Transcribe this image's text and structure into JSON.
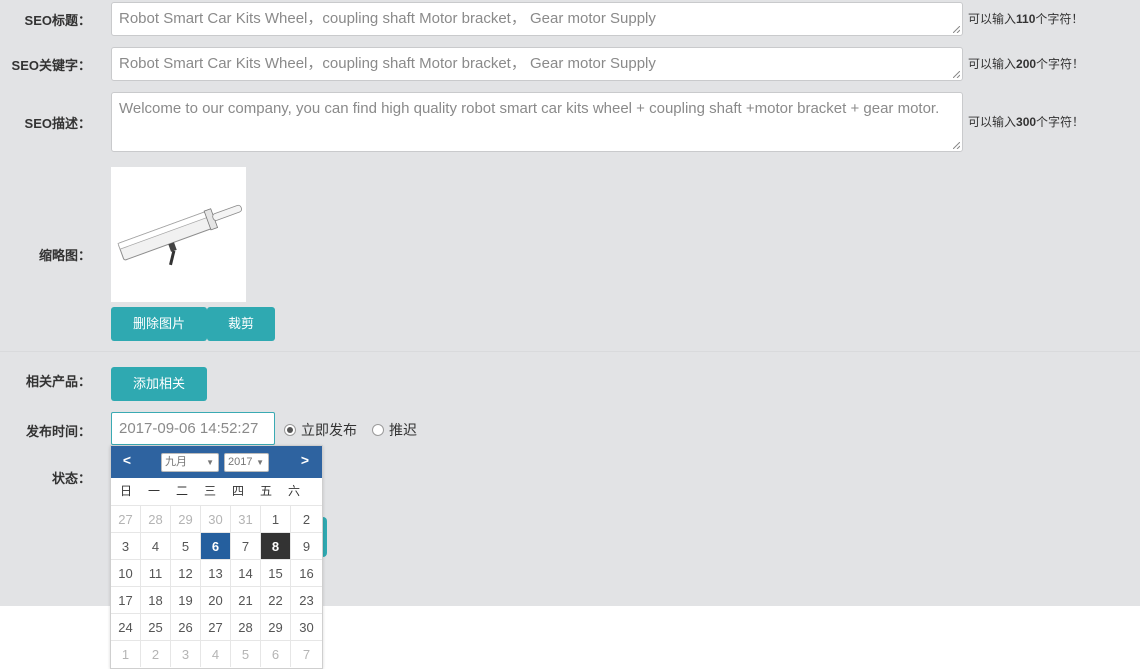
{
  "seo": {
    "title_label": "SEO标题：",
    "title_value": "Robot Smart Car Kits Wheel，coupling shaft  Motor bracket， Gear motor Supply",
    "title_hint_pre": "可以输入",
    "title_hint_num": "110",
    "title_hint_post": "个字符！",
    "keywords_label": "SEO关键字：",
    "keywords_value": "Robot Smart Car Kits Wheel，coupling shaft  Motor bracket， Gear motor Supply",
    "keywords_hint_pre": "可以输入",
    "keywords_hint_num": "200",
    "keywords_hint_post": "个字符！",
    "desc_label": "SEO描述：",
    "desc_value": "Welcome to our company, you can find high quality robot smart car kits wheel + coupling shaft +motor bracket + gear motor.",
    "desc_hint_pre": "可以输入",
    "desc_hint_num": "300",
    "desc_hint_post": "个字符！"
  },
  "thumbnail": {
    "label": "缩略图：",
    "delete_button": "删除图片",
    "crop_button": "裁剪"
  },
  "related": {
    "label": "相关产品：",
    "add_button": "添加相关"
  },
  "publish": {
    "label": "发布时间：",
    "datetime_value": "2017-09-06 14:52:27",
    "option_now": "立即发布",
    "option_delay": "推迟"
  },
  "status": {
    "label": "状态："
  },
  "calendar": {
    "month": "九月",
    "year": "2017",
    "prev": "<",
    "next": ">",
    "weekdays": [
      "日",
      "一",
      "二",
      "三",
      "四",
      "五",
      "六"
    ],
    "weeks": [
      [
        "27",
        "28",
        "29",
        "30",
        "31",
        "1",
        "2"
      ],
      [
        "3",
        "4",
        "5",
        "6",
        "7",
        "8",
        "9"
      ],
      [
        "10",
        "11",
        "12",
        "13",
        "14",
        "15",
        "16"
      ],
      [
        "17",
        "18",
        "19",
        "20",
        "21",
        "22",
        "23"
      ],
      [
        "24",
        "25",
        "26",
        "27",
        "28",
        "29",
        "30"
      ],
      [
        "1",
        "2",
        "3",
        "4",
        "5",
        "6",
        "7"
      ]
    ],
    "selected_day": "6",
    "today_day": "8"
  },
  "colors": {
    "accent": "#2fa9b1",
    "calendar_header": "#2e63a0",
    "selected": "#255f9e",
    "today": "#333333"
  }
}
